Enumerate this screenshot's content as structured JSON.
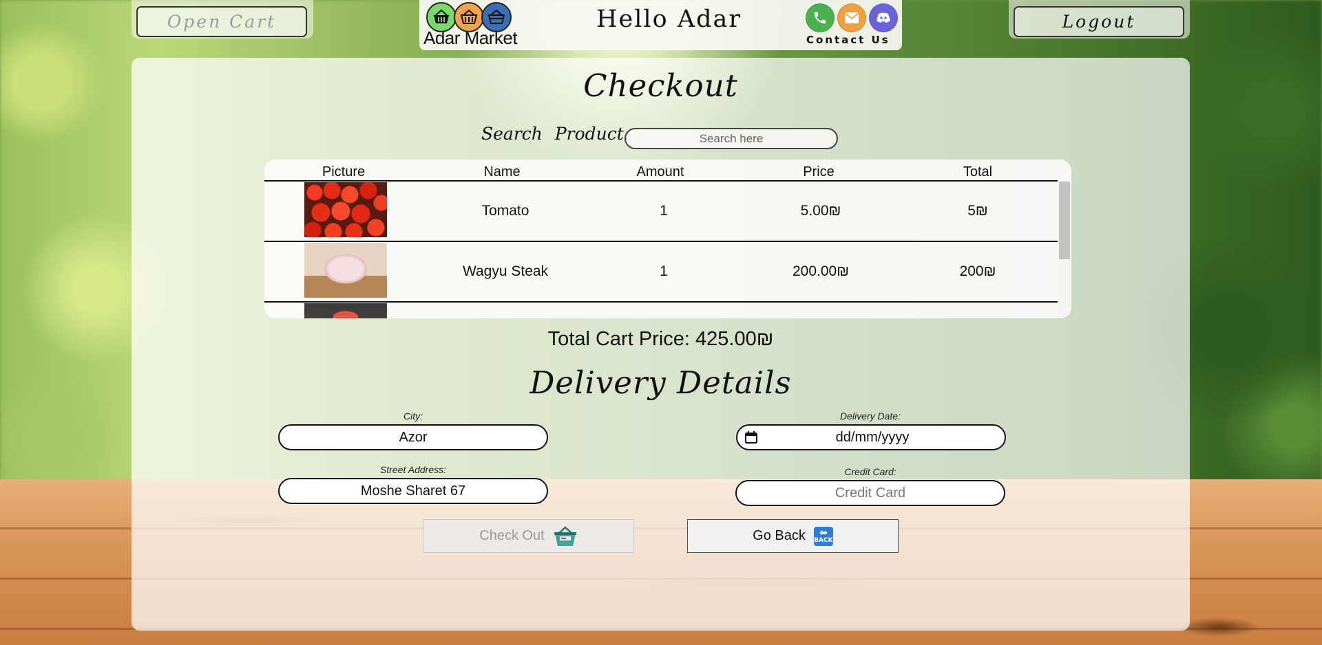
{
  "header": {
    "open_cart_label": "Open Cart",
    "logout_label": "Logout",
    "brand_name": "Adar Market",
    "greeting": "Hello Adar",
    "contact_label": "Contact Us"
  },
  "checkout": {
    "title": "Checkout",
    "search_label": "Search Product:",
    "search_placeholder": "Search here",
    "table": {
      "columns": [
        "Picture",
        "Name",
        "Amount",
        "Price",
        "Total"
      ],
      "rows": [
        {
          "image_icon": "tomato-image",
          "name": "Tomato",
          "amount": "1",
          "price": "5.00₪",
          "total": "5₪"
        },
        {
          "image_icon": "wagyu-steak-image",
          "name": "Wagyu Steak",
          "amount": "1",
          "price": "200.00₪",
          "total": "200₪"
        },
        {
          "image_icon": "product-image",
          "name": "",
          "amount": "",
          "price": "",
          "total": ""
        }
      ]
    },
    "total_cart_price": "Total Cart Price: 425.00₪"
  },
  "delivery": {
    "title": "Delivery Details",
    "city_label": "City:",
    "city_value": "Azor",
    "street_label": "Street Address:",
    "street_value": "Moshe Sharet 67",
    "date_label": "Delivery Date:",
    "date_value": "dd/mm/yyyy",
    "credit_label": "Credit Card:",
    "credit_placeholder": "Credit Card"
  },
  "actions": {
    "checkout_label": "Check Out",
    "go_back_label": "Go Back",
    "back_icon_text": "BACK"
  },
  "colors": {
    "phone": "#4caf50",
    "mail": "#f0a040",
    "discord": "#6c63d9",
    "basket_green": "#7bd86a",
    "basket_orange": "#f0a24c",
    "basket_blue": "#3a6fb8"
  }
}
